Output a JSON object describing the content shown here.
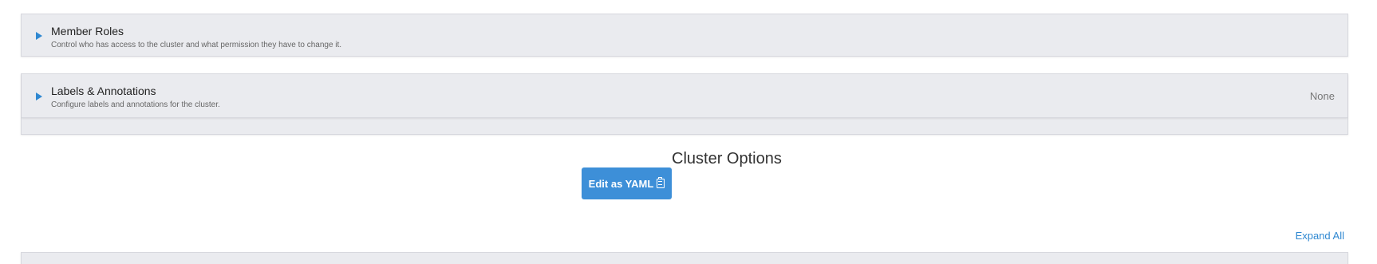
{
  "member_roles": {
    "title": "Member Roles",
    "description": "Control who has access to the cluster and what permission they have to change it."
  },
  "labels_annotations": {
    "title": "Labels & Annotations",
    "description": "Configure labels and annotations for the cluster.",
    "value": "None"
  },
  "cluster_options": {
    "title": "Cluster Options",
    "edit_yaml_label": "Edit as YAML",
    "expand_all_label": "Expand All"
  },
  "icons": {
    "caret": "caret-right-icon",
    "clipboard": "clipboard-icon"
  },
  "colors": {
    "accent": "#3d8fd8",
    "panel_bg": "#eaebef"
  }
}
